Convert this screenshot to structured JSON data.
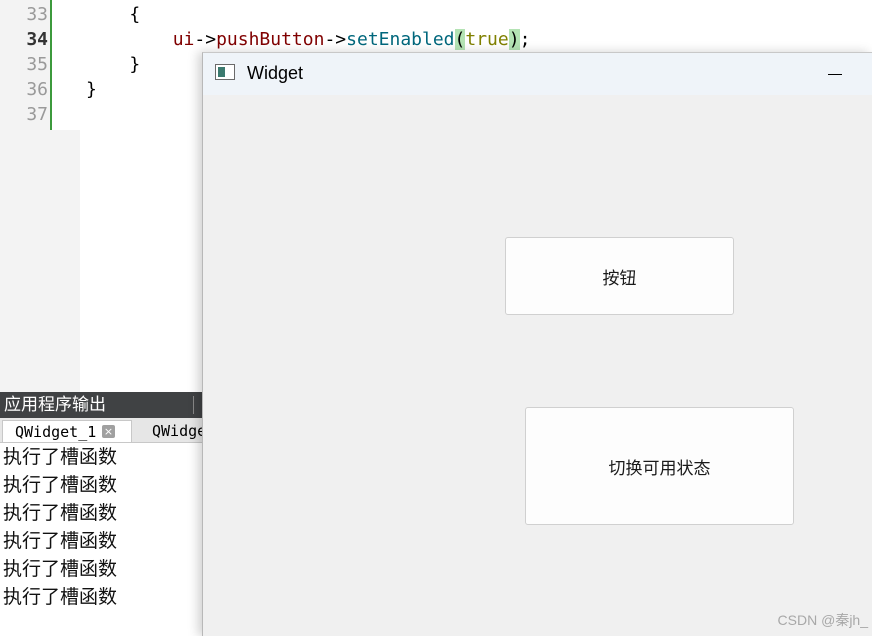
{
  "editor": {
    "lines": [
      {
        "num": "33",
        "code": "    {"
      },
      {
        "num": "34",
        "current": true
      },
      {
        "num": "35",
        "code": "    }"
      },
      {
        "num": "36",
        "code": "}"
      },
      {
        "num": "37",
        "code": ""
      }
    ],
    "line34_tokens": {
      "indent": "        ",
      "var": "ui",
      "arrow1": "->",
      "member": "pushButton",
      "arrow2": "->",
      "fn": "setEnabled",
      "open_paren": "(",
      "kw": "true",
      "close_paren": ")",
      "semi": ";"
    }
  },
  "output": {
    "header": "应用程序输出",
    "tabs": [
      {
        "label": "QWidget_1",
        "active": true
      },
      {
        "label": "QWidge",
        "active": false
      }
    ],
    "close_glyph": "×",
    "lines": [
      "执行了槽函数",
      "执行了槽函数",
      "执行了槽函数",
      "执行了槽函数",
      "执行了槽函数",
      "执行了槽函数"
    ]
  },
  "window": {
    "title": "Widget",
    "minimize_glyph": "—",
    "buttons": {
      "push_button": "按钮",
      "toggle_button": "切换可用状态"
    },
    "watermark": "CSDN @秦jh_"
  },
  "colors": {
    "gutter_accent": "#3c9a3c",
    "keyword": "#808000",
    "function": "#00677c",
    "member": "#800000",
    "paren_highlight": "#b4e3b4"
  }
}
